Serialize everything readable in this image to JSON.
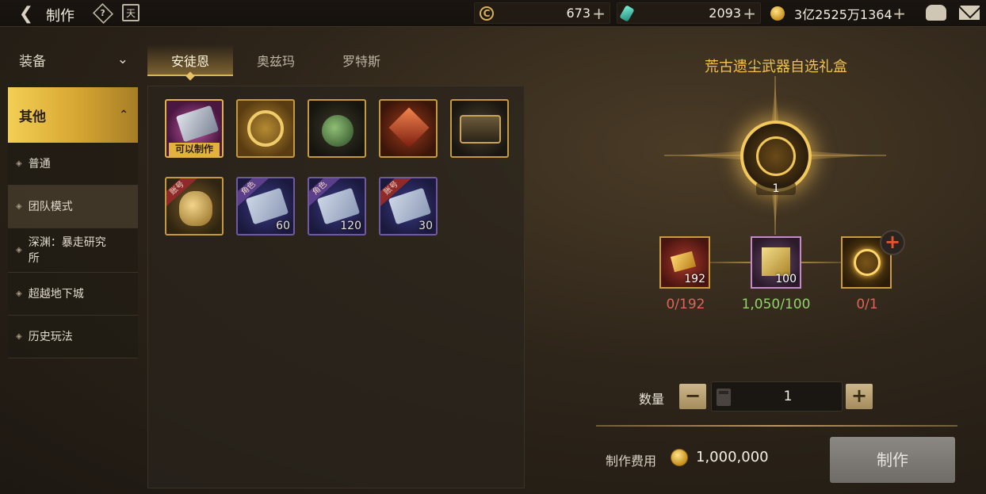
{
  "header": {
    "title": "制作",
    "help_icon": "?",
    "calendar_icon": "天"
  },
  "currencies": [
    {
      "icon": "c-coin-icon",
      "value": "673"
    },
    {
      "icon": "teal-crystal-icon",
      "value": "2093"
    },
    {
      "icon": "gold-coin-icon",
      "value": "3亿2525万1364"
    }
  ],
  "sidebar": {
    "equipment": "装备",
    "other": "其他",
    "subitems": [
      {
        "label": "普通"
      },
      {
        "label": "团队模式"
      },
      {
        "label": "深渊：暴走研究所"
      },
      {
        "label": "超越地下城"
      },
      {
        "label": "历史玩法"
      }
    ]
  },
  "tabs": [
    "安徒恩",
    "奥兹玛",
    "罗特斯"
  ],
  "items": [
    {
      "name": "ticket-craftable",
      "tag": "可以制作",
      "count": ""
    },
    {
      "name": "golden-astrolabe",
      "tag": "",
      "count": ""
    },
    {
      "name": "green-jar",
      "tag": "",
      "count": ""
    },
    {
      "name": "red-crystal",
      "tag": "",
      "count": ""
    },
    {
      "name": "dark-chest",
      "tag": "",
      "count": ""
    },
    {
      "name": "gold-sack",
      "ribbon": "账号",
      "count": ""
    },
    {
      "name": "blue-ticket",
      "ribbon": "角色",
      "count": "60"
    },
    {
      "name": "blue-ticket",
      "ribbon": "角色",
      "count": "120"
    },
    {
      "name": "blue-ticket",
      "ribbon": "账号",
      "count": "30"
    }
  ],
  "detail": {
    "title": "荒古遗尘武器自选礼盒",
    "main_count": "1",
    "materials": [
      {
        "count": "192",
        "progress": "0/192",
        "color": "#e0635a"
      },
      {
        "count": "100",
        "progress": "1,050/100",
        "color": "#8fd46a"
      },
      {
        "count": "",
        "progress": "0/1",
        "color": "#e0635a"
      }
    ]
  },
  "quantity": {
    "label": "数量",
    "value": "1",
    "minus": "−",
    "plus": "+"
  },
  "cost": {
    "label": "制作费用",
    "value": "1,000,000"
  },
  "craft_button": "制作"
}
